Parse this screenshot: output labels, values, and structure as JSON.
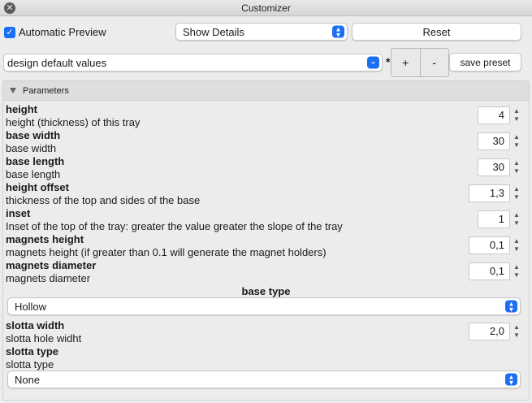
{
  "window": {
    "title": "Customizer"
  },
  "toolbar": {
    "auto_preview_label": "Automatic Preview",
    "auto_preview_checked": true,
    "details_select": "Show Details",
    "reset_label": "Reset",
    "preset_select": "design default values",
    "modified_marker": "*",
    "add_label": "+",
    "remove_label": "-",
    "save_preset_label": "save preset"
  },
  "section": {
    "title": "Parameters",
    "expanded": true
  },
  "parameters": [
    {
      "name": "height",
      "description": "height (thickness) of this tray",
      "value": "4"
    },
    {
      "name": "base width",
      "description": "base width",
      "value": "30"
    },
    {
      "name": "base length",
      "description": "base length",
      "value": "30"
    },
    {
      "name": "height offset",
      "description": "thickness of the top and sides of the base",
      "value": "1,3"
    },
    {
      "name": "inset",
      "description": "Inset of the top of the tray: greater the value greater the slope of the tray",
      "value": "1"
    },
    {
      "name": "magnets height",
      "description": "magnets height (if greater than 0.1 will generate the magnet holders)",
      "value": "0,1"
    },
    {
      "name": "magnets diameter",
      "description": "magnets diameter",
      "value": "0,1"
    }
  ],
  "base_type": {
    "label": "base type",
    "value": "Hollow"
  },
  "slotta_width": {
    "name": "slotta width",
    "description": "slotta hole widht",
    "value": "2,0"
  },
  "slotta_type": {
    "name": "slotta type",
    "description": "slotta type",
    "value": "None"
  },
  "colors": {
    "accent": "#1c6ef2",
    "panel_bg": "#ececec"
  }
}
